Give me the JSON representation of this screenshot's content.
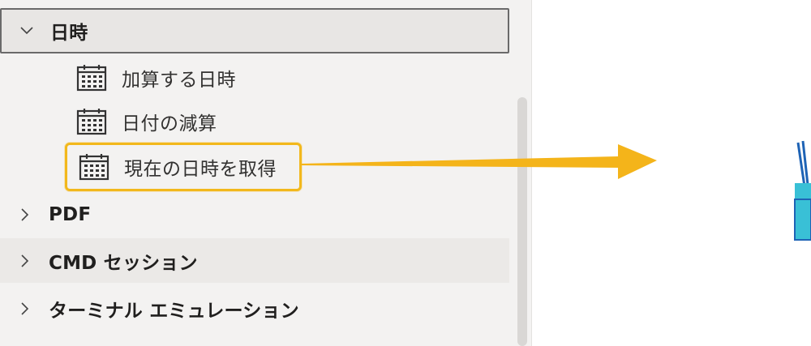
{
  "panel": {
    "groups": [
      {
        "label": "日時",
        "expanded": true
      },
      {
        "label": "PDF",
        "expanded": false
      },
      {
        "label": "CMD セッション",
        "expanded": false
      },
      {
        "label": "ターミナル エミュレーション",
        "expanded": false
      }
    ],
    "datetime_actions": [
      {
        "label": "加算する日時",
        "icon": "calendar-icon"
      },
      {
        "label": "日付の減算",
        "icon": "calendar-icon"
      },
      {
        "label": "現在の日時を取得",
        "icon": "calendar-icon",
        "highlighted": true
      }
    ]
  },
  "colors": {
    "highlight_border": "#f2b81c",
    "arrow": "#f4b41a",
    "panel_bg": "#f3f2f1"
  }
}
